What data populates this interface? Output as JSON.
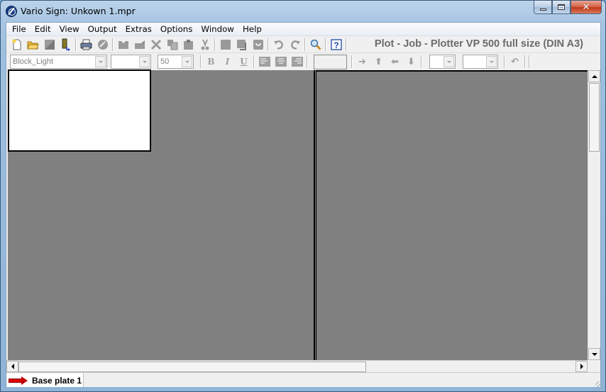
{
  "window": {
    "title": "Vario Sign: Unkown 1.mpr",
    "controls": {
      "minimize": "minimize",
      "maximize": "maximize",
      "close": "✕"
    }
  },
  "menubar": {
    "items": [
      "File",
      "Edit",
      "View",
      "Output",
      "Extras",
      "Options",
      "Window",
      "Help"
    ]
  },
  "toolbar": {
    "job_title": "Plot - Job - Plotter VP 500 full size (DIN A3)",
    "icons": [
      "new-file-icon",
      "open-folder-icon",
      "save-icon",
      "import-icon",
      "print-icon",
      "stop-icon",
      "cut-group-icon",
      "paste-group-icon",
      "delete-icon",
      "copy-icon",
      "paste-icon",
      "scissors-icon",
      "frame-icon",
      "frame-shadow-icon",
      "rotate-icon",
      "undo-icon",
      "redo-icon",
      "zoom-icon",
      "help-icon"
    ]
  },
  "format_bar": {
    "font": {
      "value": "Block_Light"
    },
    "style": {
      "value": ""
    },
    "size": {
      "value": "50"
    },
    "bold": "B",
    "italic": "I",
    "underline": "U",
    "value_field": "",
    "combo4": {
      "value": ""
    },
    "combo5": {
      "value": ""
    }
  },
  "status": {
    "tab_label": "Base plate 1",
    "tab_arrow_color": "#e00000"
  },
  "colors": {
    "workspace": "#808080",
    "paper": "#ffffff",
    "job_title": "#6b6b6b"
  }
}
